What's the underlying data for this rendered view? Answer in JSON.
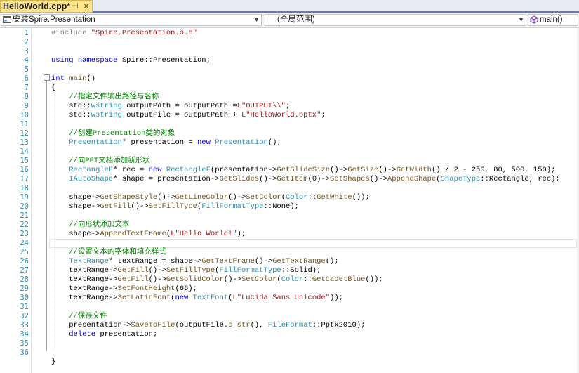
{
  "tab": {
    "title": "HelloWorld.cpp*",
    "pin_glyph": "⊣",
    "close_glyph": "×"
  },
  "navbar": {
    "scope": "安装Spire.Presentation",
    "range": "(全局范围)",
    "function": "main()"
  },
  "colors": {
    "tab_active": "#ffe48c",
    "line_number": "#2b91af",
    "keyword": "#0000ff",
    "string": "#a31515",
    "comment": "#008000",
    "type": "#2b91af"
  },
  "icons": {
    "project": "project-icon",
    "function": "function-icon"
  },
  "editor": {
    "current_line": 24,
    "lines": [
      {
        "n": "1",
        "tokens": [
          [
            "p",
            "#include "
          ],
          [
            "s",
            "\"Spire.Presentation.o.h\""
          ]
        ]
      },
      {
        "n": "2",
        "tokens": []
      },
      {
        "n": "3",
        "tokens": []
      },
      {
        "n": "4",
        "tokens": [
          [
            "k",
            "using"
          ],
          [
            "",
            "",
            " "
          ],
          [
            "k",
            "namespace"
          ],
          [
            "",
            " Spire::Presentation;"
          ]
        ]
      },
      {
        "n": "5",
        "tokens": []
      },
      {
        "n": "6",
        "tokens": [
          [
            "k",
            "int"
          ],
          [
            "",
            " "
          ],
          [
            "f",
            "main"
          ],
          [
            "",
            "()"
          ]
        ]
      },
      {
        "n": "7",
        "tokens": [
          [
            "",
            "{"
          ]
        ]
      },
      {
        "n": "8",
        "tokens": [
          [
            "",
            "    "
          ],
          [
            "c",
            "//指定文件输出路径与名称"
          ]
        ]
      },
      {
        "n": "9",
        "tokens": [
          [
            "",
            "    std::"
          ],
          [
            "t",
            "wstring"
          ],
          [
            "",
            " outputPath = outputPath ="
          ],
          [
            "s",
            "L\"OUTPUT\\\\\""
          ],
          [
            "",
            ";"
          ]
        ]
      },
      {
        "n": "10",
        "tokens": [
          [
            "",
            "    std::"
          ],
          [
            "t",
            "wstring"
          ],
          [
            "",
            " outputFile = outputPath + "
          ],
          [
            "s",
            "L\"HelloWorld.pptx\""
          ],
          [
            "",
            ";"
          ]
        ]
      },
      {
        "n": "11",
        "tokens": []
      },
      {
        "n": "12",
        "tokens": [
          [
            "",
            "    "
          ],
          [
            "c",
            "//创建Presentation类的对象"
          ]
        ]
      },
      {
        "n": "13",
        "tokens": [
          [
            "",
            "    "
          ],
          [
            "t",
            "Presentation"
          ],
          [
            "",
            "* presentation = "
          ],
          [
            "k",
            "new"
          ],
          [
            "",
            " "
          ],
          [
            "t",
            "Presentation"
          ],
          [
            "",
            "();"
          ]
        ]
      },
      {
        "n": "14",
        "tokens": []
      },
      {
        "n": "15",
        "tokens": [
          [
            "",
            "    "
          ],
          [
            "c",
            "//向PPT文档添加新形状"
          ]
        ]
      },
      {
        "n": "16",
        "tokens": [
          [
            "",
            "    "
          ],
          [
            "t",
            "RectangleF"
          ],
          [
            "",
            "* rec = "
          ],
          [
            "k",
            "new"
          ],
          [
            "",
            " "
          ],
          [
            "t",
            "RectangleF"
          ],
          [
            "",
            "(presentation->"
          ],
          [
            "f",
            "GetSlideSize"
          ],
          [
            "",
            "()->"
          ],
          [
            "f",
            "GetSize"
          ],
          [
            "",
            "()->"
          ],
          [
            "f",
            "GetWidth"
          ],
          [
            "",
            "() / 2 - 250, 80, 500, 150);"
          ]
        ]
      },
      {
        "n": "17",
        "tokens": [
          [
            "",
            "    "
          ],
          [
            "t",
            "IAutoShape"
          ],
          [
            "",
            "* shape = presentation->"
          ],
          [
            "f",
            "GetSlides"
          ],
          [
            "",
            "()->"
          ],
          [
            "f",
            "GetItem"
          ],
          [
            "",
            "(0)->"
          ],
          [
            "f",
            "GetShapes"
          ],
          [
            "",
            "()->"
          ],
          [
            "f",
            "AppendShape"
          ],
          [
            "",
            "("
          ],
          [
            "t",
            "ShapeType"
          ],
          [
            "",
            "::Rectangle, rec);"
          ]
        ]
      },
      {
        "n": "18",
        "tokens": []
      },
      {
        "n": "19",
        "tokens": [
          [
            "",
            "    shape->"
          ],
          [
            "f",
            "GetShapeStyle"
          ],
          [
            "",
            "()->"
          ],
          [
            "f",
            "GetLineColor"
          ],
          [
            "",
            "()->"
          ],
          [
            "f",
            "SetColor"
          ],
          [
            "",
            "("
          ],
          [
            "t",
            "Color"
          ],
          [
            "",
            "::"
          ],
          [
            "f",
            "GetWhite"
          ],
          [
            "",
            "());"
          ]
        ]
      },
      {
        "n": "20",
        "tokens": [
          [
            "",
            "    shape->"
          ],
          [
            "f",
            "GetFill"
          ],
          [
            "",
            "()->"
          ],
          [
            "f",
            "SetFillType"
          ],
          [
            "",
            "("
          ],
          [
            "t",
            "FillFormatType"
          ],
          [
            "",
            "::None);"
          ]
        ]
      },
      {
        "n": "21",
        "tokens": []
      },
      {
        "n": "22",
        "tokens": [
          [
            "",
            "    "
          ],
          [
            "c",
            "//向形状添加文本"
          ]
        ]
      },
      {
        "n": "23",
        "tokens": [
          [
            "",
            "    shape->"
          ],
          [
            "f",
            "AppendTextFrame"
          ],
          [
            "",
            "("
          ],
          [
            "s",
            "L\"Hello World!\""
          ],
          [
            "",
            ");"
          ]
        ]
      },
      {
        "n": "24",
        "tokens": []
      },
      {
        "n": "25",
        "tokens": [
          [
            "",
            "    "
          ],
          [
            "c",
            "//设置文本的字体和填充样式"
          ]
        ]
      },
      {
        "n": "26",
        "tokens": [
          [
            "",
            "    "
          ],
          [
            "t",
            "TextRange"
          ],
          [
            "",
            "* textRange = shape->"
          ],
          [
            "f",
            "GetTextFrame"
          ],
          [
            "",
            "()->"
          ],
          [
            "f",
            "GetTextRange"
          ],
          [
            "",
            "();"
          ]
        ]
      },
      {
        "n": "27",
        "tokens": [
          [
            "",
            "    textRange->"
          ],
          [
            "f",
            "GetFill"
          ],
          [
            "",
            "()->"
          ],
          [
            "f",
            "SetFillType"
          ],
          [
            "",
            "("
          ],
          [
            "t",
            "FillFormatType"
          ],
          [
            "",
            "::Solid);"
          ]
        ]
      },
      {
        "n": "28",
        "tokens": [
          [
            "",
            "    textRange->"
          ],
          [
            "f",
            "GetFill"
          ],
          [
            "",
            "()->"
          ],
          [
            "f",
            "GetSolidColor"
          ],
          [
            "",
            "()->"
          ],
          [
            "f",
            "SetColor"
          ],
          [
            "",
            "("
          ],
          [
            "t",
            "Color"
          ],
          [
            "",
            "::"
          ],
          [
            "f",
            "GetCadetBlue"
          ],
          [
            "",
            "());"
          ]
        ]
      },
      {
        "n": "29",
        "tokens": [
          [
            "",
            "    textRange->"
          ],
          [
            "f",
            "SetFontHeight"
          ],
          [
            "",
            "(66);"
          ]
        ]
      },
      {
        "n": "30",
        "tokens": [
          [
            "",
            "    textRange->"
          ],
          [
            "f",
            "SetLatinFont"
          ],
          [
            "",
            "("
          ],
          [
            "k",
            "new"
          ],
          [
            "",
            " "
          ],
          [
            "t",
            "TextFont"
          ],
          [
            "",
            "("
          ],
          [
            "s",
            "L\"Lucida Sans Unicode\""
          ],
          [
            "",
            "));"
          ]
        ]
      },
      {
        "n": "31",
        "tokens": []
      },
      {
        "n": "32",
        "tokens": [
          [
            "",
            "    "
          ],
          [
            "c",
            "//保存文件"
          ]
        ]
      },
      {
        "n": "33",
        "tokens": [
          [
            "",
            "    presentation->"
          ],
          [
            "f",
            "SaveToFile"
          ],
          [
            "",
            "(outputFile."
          ],
          [
            "f",
            "c_str"
          ],
          [
            "",
            "(), "
          ],
          [
            "t",
            "FileFormat"
          ],
          [
            "",
            "::Pptx2010);"
          ]
        ]
      },
      {
        "n": "34",
        "tokens": [
          [
            "",
            "    "
          ],
          [
            "k",
            "delete"
          ],
          [
            "",
            " presentation;"
          ]
        ]
      },
      {
        "n": "35",
        "tokens": []
      },
      {
        "n": "36",
        "tokens": []
      },
      {
        "n": "",
        "tokens": [
          [
            "",
            "}"
          ]
        ]
      }
    ]
  }
}
